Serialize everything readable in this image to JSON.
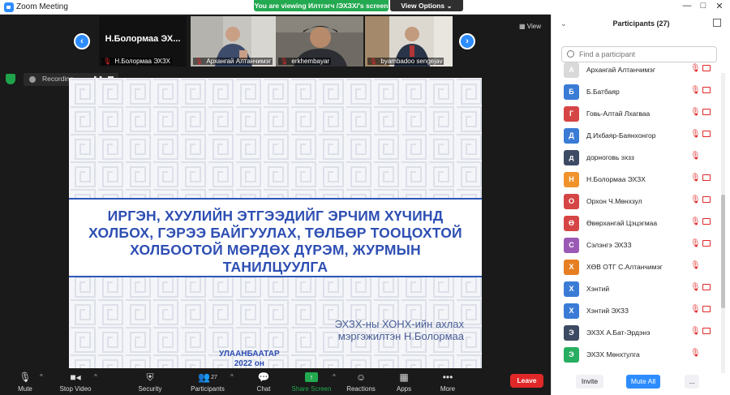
{
  "app": {
    "title": "Zoom Meeting"
  },
  "banner": {
    "viewing": "You are viewing Илтгэгч /ЭХЗХ/'s screen",
    "view_options": "View Options"
  },
  "video_strip": {
    "view_label": "View",
    "tiles": [
      {
        "label": "Н.Болормаа  ЭХ...",
        "name": "Н.Болормаа ЭХЗХ"
      },
      {
        "name": "Архангай Алтанчимэг"
      },
      {
        "name": "erkhembayar"
      },
      {
        "name": "byambadoo sengejav"
      }
    ]
  },
  "recording": {
    "text": "Recording..."
  },
  "slide": {
    "title_lines": [
      "ИРГЭН, ХУУЛИЙН ЭТГЭЭДИЙГ ЭРЧИМ ХҮЧИНД",
      "ХОЛБОХ, ГЭРЭЭ БАЙГУУЛАХ, ТӨЛБӨР ТООЦОХТОЙ",
      "ХОЛБООТОЙ МӨРДӨХ ДҮРЭМ, ЖУРМЫН",
      "ТАНИЛЦУУЛГА"
    ],
    "author_lines": [
      "ЭХЗХ-ны ХОНХ-ийн ахлах",
      "мэргэжилтэн Н.Болормаа"
    ],
    "city_lines": [
      "УЛААНБААТАР",
      "2022 он"
    ]
  },
  "toolbar": {
    "mute": "Mute",
    "stop_video": "Stop Video",
    "security": "Security",
    "participants": "Participants",
    "participants_count": "27",
    "chat": "Chat",
    "share_screen": "Share Screen",
    "reactions": "Reactions",
    "apps": "Apps",
    "more": "More",
    "leave": "Leave"
  },
  "panel": {
    "title": "Participants (27)",
    "search_placeholder": "Find a participant",
    "invite": "Invite",
    "mute_all": "Mute All",
    "more": "...",
    "participants": [
      {
        "initial": "А",
        "name": "Архангай Алтанчимэг",
        "color": "#d9d9d9",
        "mic_muted": true,
        "cam_off": true
      },
      {
        "initial": "Б",
        "name": "Б.Батбаяр",
        "color": "#3a7bd5",
        "mic_muted": true,
        "cam_off": true
      },
      {
        "initial": "Г",
        "name": "Говь-Алтай Лхагваа",
        "color": "#d64545",
        "mic_muted": true,
        "cam_off": true
      },
      {
        "initial": "Д",
        "name": "Д.Ихбаяр-Баянхонгор",
        "color": "#3a7bd5",
        "mic_muted": true,
        "cam_off": true
      },
      {
        "initial": "д",
        "name": "дорноговь эхзз",
        "color": "#3d4a63",
        "mic_muted": true,
        "cam_off": false
      },
      {
        "initial": "Н",
        "name": "Н.Болормаа ЭХЗХ",
        "color": "#f0932b",
        "mic_muted": true,
        "cam_off": true
      },
      {
        "initial": "О",
        "name": "Орхон Ч.Мөнхзул",
        "color": "#d64545",
        "mic_muted": true,
        "cam_off": true
      },
      {
        "initial": "Ө",
        "name": "Өвөрхангай Цэцэгмаа",
        "color": "#d64545",
        "mic_muted": true,
        "cam_off": true
      },
      {
        "initial": "С",
        "name": "Сэлэнгэ ЭХЗЗ",
        "color": "#9b59b6",
        "mic_muted": true,
        "cam_off": true
      },
      {
        "initial": "Х",
        "name": "ХӨВ ОТГ С.Алтанчимэг",
        "color": "#e67e22",
        "mic_muted": true,
        "cam_off": false
      },
      {
        "initial": "Х",
        "name": "Хэнтий",
        "color": "#3a7bd5",
        "mic_muted": true,
        "cam_off": true
      },
      {
        "initial": "Х",
        "name": "Хэнтий ЭХЗЗ",
        "color": "#3a7bd5",
        "mic_muted": true,
        "cam_off": true
      },
      {
        "initial": "Э",
        "name": "ЭХЗХ А.Бат-Эрдэнэ",
        "color": "#3d4a63",
        "mic_muted": true,
        "cam_off": true
      },
      {
        "initial": "Э",
        "name": "ЭХЗХ Мөнхтулга",
        "color": "#27ae60",
        "mic_muted": true,
        "cam_off": false
      }
    ]
  },
  "colors": {
    "accent": "#2d8cff",
    "leave": "#e02828",
    "share": "#23a950",
    "slide_title": "#2e4fb3"
  }
}
